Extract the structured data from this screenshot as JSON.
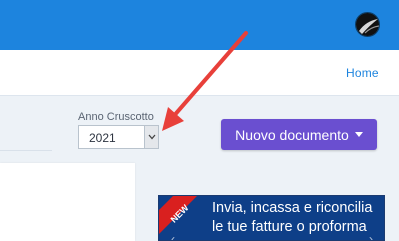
{
  "header": {
    "avatar_icon": "user-avatar",
    "accent_color": "#1d84de"
  },
  "nav": {
    "home_label": "Home"
  },
  "filter": {
    "year_label": "Anno Cruscotto",
    "year_value": "2021",
    "dropdown_icon": "chevron-down-icon"
  },
  "actions": {
    "new_document_label": "Nuovo documento",
    "new_document_color": "#6a4fd0"
  },
  "banner": {
    "badge": "NEW",
    "line1": "Invia, incassa e riconcilia",
    "line2": "le tue fatture o proforma"
  },
  "annotation": {
    "arrow_color": "#e8403a"
  }
}
